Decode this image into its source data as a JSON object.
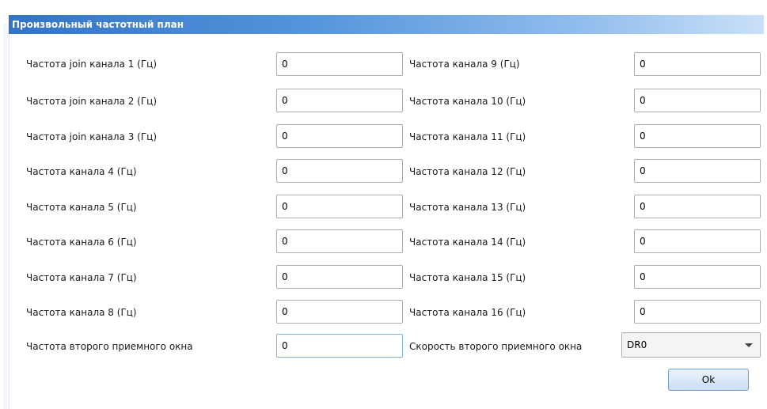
{
  "dialog": {
    "title": "Произвольный частотный план"
  },
  "left_column": [
    {
      "label": "Частота join канала 1 (Гц)",
      "value": "0"
    },
    {
      "label": "Частота join канала 2 (Гц)",
      "value": "0"
    },
    {
      "label": "Частота join канала 3 (Гц)",
      "value": "0"
    },
    {
      "label": "Частота канала 4 (Гц)",
      "value": "0"
    },
    {
      "label": "Частота канала 5 (Гц)",
      "value": "0"
    },
    {
      "label": "Частота канала 6 (Гц)",
      "value": "0"
    },
    {
      "label": "Частота канала 7 (Гц)",
      "value": "0"
    },
    {
      "label": "Частота канала 8 (Гц)",
      "value": "0"
    }
  ],
  "right_column": [
    {
      "label": "Частота канала 9 (Гц)",
      "value": "0"
    },
    {
      "label": "Частота канала 10 (Гц)",
      "value": "0"
    },
    {
      "label": "Частота канала 11 (Гц)",
      "value": "0"
    },
    {
      "label": "Частота канала 12 (Гц)",
      "value": "0"
    },
    {
      "label": "Частота канала 13 (Гц)",
      "value": "0"
    },
    {
      "label": "Частота канала 14 (Гц)",
      "value": "0"
    },
    {
      "label": "Частота канала 15 (Гц)",
      "value": "0"
    },
    {
      "label": "Частота канала 16 (Гц)",
      "value": "0"
    }
  ],
  "rx2": {
    "frequency_label": "Частота второго приемного окна",
    "frequency_value": "0",
    "speed_label": "Скорость второго приемного окна",
    "speed_value": "DR0"
  },
  "buttons": {
    "ok_label": "Ok"
  },
  "colors": {
    "title_bar_start": "#3373c6",
    "title_bar_end": "#c9e0f7",
    "focused_border": "#7eb4ea"
  },
  "icons": {
    "dropdown": "chevron-down-icon"
  }
}
